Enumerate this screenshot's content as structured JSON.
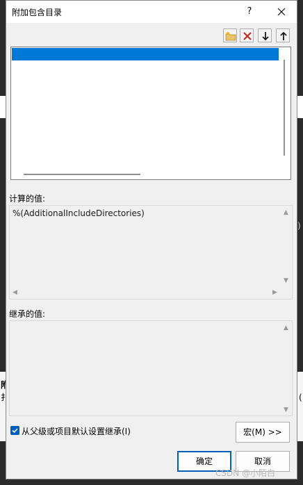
{
  "dialog": {
    "title": "附加包含目录",
    "help_label": "?"
  },
  "toolbar": {
    "icons": [
      "new-line-icon",
      "delete-icon",
      "move-down-icon",
      "move-up-icon"
    ]
  },
  "list": {
    "items": [
      ""
    ]
  },
  "computed": {
    "label": "计算的值:",
    "value": "%(AdditionalIncludeDirectories)"
  },
  "inherited": {
    "label": "继承的值:",
    "value": ""
  },
  "inherit_checkbox": {
    "label": "从父级或项目默认设置继承(I)",
    "checked": true
  },
  "buttons": {
    "macros": "宏(M) >>",
    "ok": "确定",
    "cancel": "取消"
  },
  "background": {
    "fragment1": "附",
    "fragment2": "扌",
    "fragment3": "(",
    "fragment4": ")"
  },
  "watermark": "CSDN @小陌白",
  "colors": {
    "selection": "#0078d7",
    "accent": "#005fb8",
    "delete": "#c42b1c"
  }
}
